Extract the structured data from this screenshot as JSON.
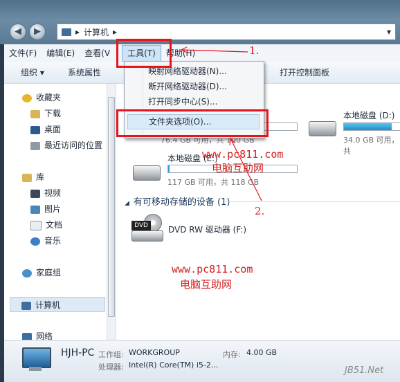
{
  "address": {
    "crumb": "计算机"
  },
  "menu": {
    "file": "文件(F)",
    "edit": "编辑(E)",
    "view": "查看(V",
    "tools": "工具(T)",
    "help": "帮助(H)"
  },
  "toolbar": {
    "organize": "组织 ▾",
    "sysprops": "系统属性",
    "control_panel": "打开控制面板"
  },
  "dropdown": {
    "items": [
      "映射网络驱动器(N)...",
      "断开网络驱动器(D)...",
      "打开同步中心(S)...",
      "文件夹选项(O)..."
    ]
  },
  "nav": {
    "favorites": "收藏夹",
    "downloads": "下载",
    "desktop": "桌面",
    "recent": "最近访问的位置",
    "libraries": "库",
    "videos": "视频",
    "pictures": "图片",
    "documents": "文档",
    "music": "音乐",
    "homegroup": "家庭组",
    "computer": "计算机",
    "network": "网络"
  },
  "drives": {
    "c_info": "76.4 GB 可用，共 100 GB",
    "d_name": "本地磁盘 (D:)",
    "d_info": "34.0 GB 可用，共",
    "e_name": "本地磁盘 (E:)",
    "e_info": "117 GB 可用，共 118 GB",
    "d_used_fraction": 0.85,
    "e_used_fraction": 0.01
  },
  "removable": {
    "header": "有可移动存储的设备 (1)",
    "dvd_name": "DVD RW 驱动器 (F:)",
    "dvd_label": "DVD"
  },
  "annotations": {
    "step1": "1.",
    "step2": "2.",
    "wm_url": "www.pc811.com",
    "wm_name": "电脑互助网",
    "jb51": "JB51.Net"
  },
  "details": {
    "pc_name": "HJH-PC",
    "workgroup_label": "工作组:",
    "workgroup": "WORKGROUP",
    "memory_label": "内存:",
    "memory": "4.00 GB",
    "cpu_label": "处理器:",
    "cpu": "Intel(R) Core(TM) i5-2..."
  },
  "colors": {
    "annotation_red": "#e8141c",
    "bar_blue": "#26a0da"
  }
}
